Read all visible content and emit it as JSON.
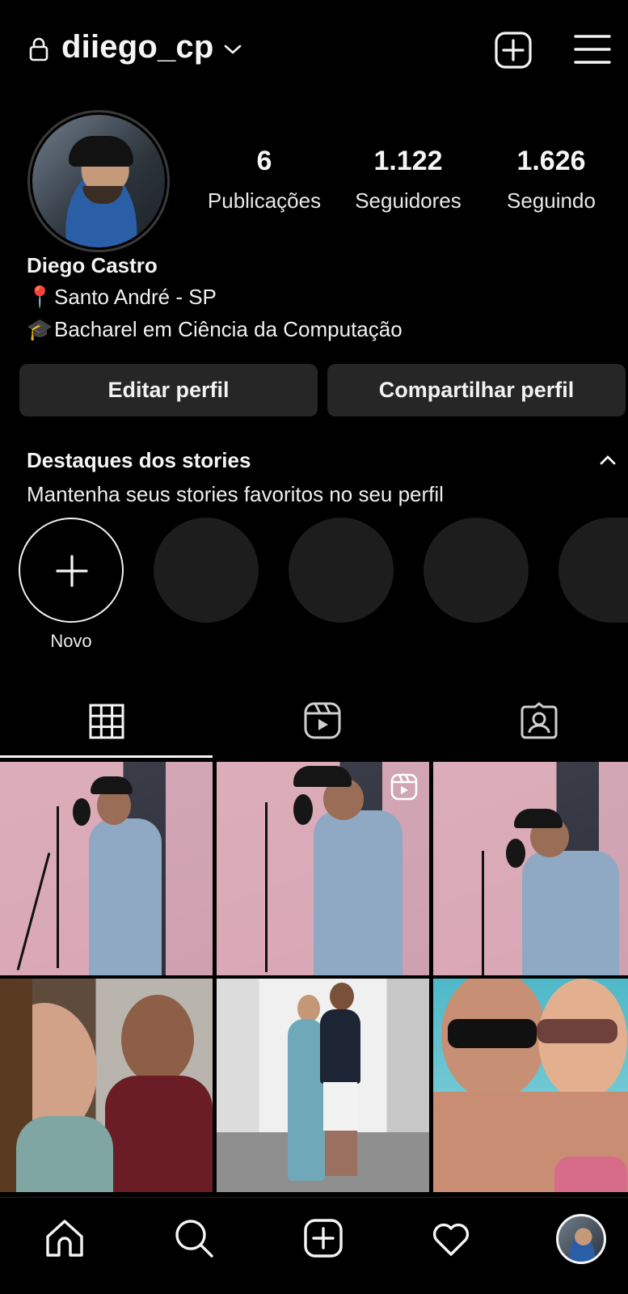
{
  "header": {
    "username": "diiego_cp",
    "icons": [
      "lock-icon",
      "chevron-down-icon",
      "add-post-icon",
      "menu-icon"
    ]
  },
  "profile": {
    "stats": [
      {
        "value": "6",
        "label": "Publicações"
      },
      {
        "value": "1.122",
        "label": "Seguidores"
      },
      {
        "value": "1.626",
        "label": "Seguindo"
      }
    ],
    "name": "Diego Castro",
    "bio": [
      {
        "icon": "📍",
        "text": "Santo André - SP"
      },
      {
        "icon": "🎓",
        "text": "Bacharel em Ciência da Computação"
      }
    ]
  },
  "actions": {
    "edit": "Editar perfil",
    "share": "Compartilhar perfil"
  },
  "highlights": {
    "title": "Destaques dos stories",
    "subtitle": "Mantenha seus stories favoritos no seu perfil",
    "new_label": "Novo"
  },
  "tabs": [
    "grid-tab",
    "reels-tab",
    "tagged-tab"
  ],
  "bottom_nav": [
    "home",
    "search",
    "create",
    "activity",
    "profile"
  ],
  "colors": {
    "background": "#000000",
    "button": "#262626",
    "text": "#f5f5f5"
  }
}
